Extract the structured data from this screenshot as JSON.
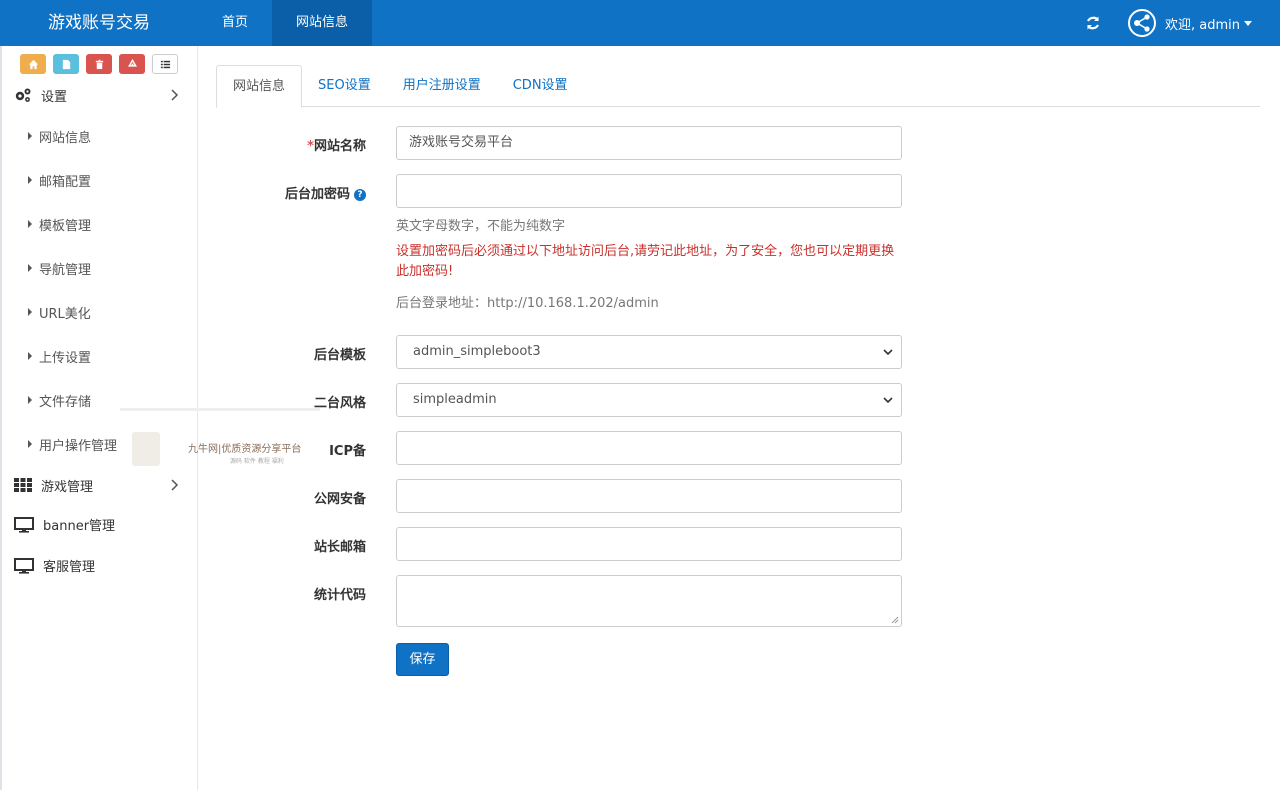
{
  "header": {
    "brand": "游戏账号交易",
    "nav": [
      "首页",
      "网站信息"
    ],
    "active_nav": 1,
    "welcome": "欢迎, admin"
  },
  "sidebar": {
    "shortcut_icons": [
      "home-icon",
      "file-icon",
      "trash-icon",
      "recycle-icon",
      "list-icon"
    ],
    "groups": [
      {
        "label": "设置",
        "icon": "gears-icon",
        "items": [
          "网站信息",
          "邮箱配置",
          "模板管理",
          "导航管理",
          "URL美化",
          "上传设置",
          "文件存储",
          "用户操作管理"
        ]
      },
      {
        "label": "游戏管理",
        "icon": "grid-icon"
      }
    ],
    "flat_items": [
      {
        "label": "banner管理",
        "icon": "monitor-icon"
      },
      {
        "label": "客服管理",
        "icon": "monitor-icon"
      }
    ]
  },
  "tabs": [
    "网站信息",
    "SEO设置",
    "用户注册设置",
    "CDN设置"
  ],
  "active_tab": 0,
  "form": {
    "site_name": {
      "required_mark": "*",
      "label": "网站名称",
      "value": "游戏账号交易平台"
    },
    "admin_password": {
      "label": "后台加密码",
      "value": "",
      "hint": "英文字母数字，不能为纯数字",
      "warning": "设置加密码后必须通过以下地址访问后台,请劳记此地址，为了安全，您也可以定期更换此加密码!",
      "login_url": "后台登录地址：http://10.168.1.202/admin"
    },
    "admin_template": {
      "label": "后台模板",
      "value": "admin_simpleboot3"
    },
    "admin_style": {
      "label": "二台风格",
      "value": "simpleadmin"
    },
    "icp": {
      "label": "ICP备",
      "value": ""
    },
    "police": {
      "label": "公网安备",
      "value": ""
    },
    "admin_email": {
      "label": "站长邮箱",
      "value": ""
    },
    "stat_code": {
      "label": "统计代码",
      "value": ""
    },
    "save_label": "保存"
  },
  "watermark": {
    "text": "九牛网|优质资源分享平台",
    "sub": "源码 软件 教程 福利"
  },
  "colors": {
    "primary": "#0f72c5",
    "warning": "#c9302c"
  }
}
